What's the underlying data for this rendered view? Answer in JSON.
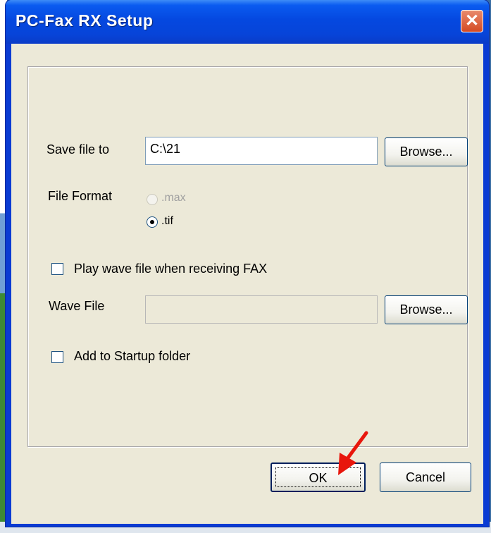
{
  "window": {
    "title": "PC-Fax RX Setup",
    "close_icon": "close-icon",
    "accent_color": "#0548e0"
  },
  "form": {
    "save_file_label": "Save file to",
    "save_file_value": "C:\\21",
    "browse_label": "Browse...",
    "file_format_label": "File Format",
    "format_options": [
      {
        "label": ".max",
        "selected": false,
        "enabled": false
      },
      {
        "label": ".tif",
        "selected": true,
        "enabled": true
      }
    ],
    "play_wave_label": "Play wave file when receiving FAX",
    "play_wave_checked": false,
    "wave_file_label": "Wave File",
    "wave_file_value": "",
    "wave_browse_label": "Browse...",
    "startup_label": "Add to Startup folder",
    "startup_checked": false
  },
  "footer": {
    "ok_label": "OK",
    "cancel_label": "Cancel"
  },
  "annotation": {
    "arrow_icon": "red-arrow-icon",
    "arrow_color": "#e8160c"
  }
}
